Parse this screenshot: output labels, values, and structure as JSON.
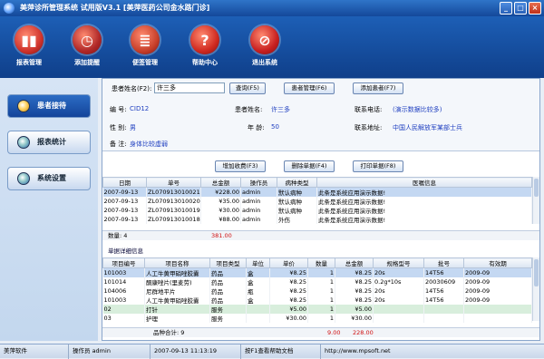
{
  "window": {
    "title": "美萍诊所管理系统 试用版V3.1 [美萍医药公司金水路门诊]",
    "minimize": "_",
    "maximize": "□",
    "close": "×"
  },
  "toolbar": [
    {
      "label": "报表管理",
      "icon": "bar-chart-icon",
      "color": "#d0342c",
      "glyph": "▮▮"
    },
    {
      "label": "添加提醒",
      "icon": "clock-icon",
      "color": "#b02828",
      "glyph": "◷"
    },
    {
      "label": "便签管理",
      "icon": "notepad-icon",
      "color": "#c8402a",
      "glyph": "≣"
    },
    {
      "label": "帮助中心",
      "icon": "help-icon",
      "color": "#d02a20",
      "glyph": "?"
    },
    {
      "label": "退出系统",
      "icon": "exit-icon",
      "color": "#c82020",
      "glyph": "⊘"
    }
  ],
  "nav": [
    {
      "label": "患者接待",
      "active": true
    },
    {
      "label": "报表统计",
      "active": false
    },
    {
      "label": "系统设置",
      "active": false
    }
  ],
  "search": {
    "label": "患者姓名(F2):",
    "value": "许三多",
    "query_btn": "查询(F5)",
    "manage_btn": "患者管理(F6)",
    "add_btn": "添加患者(F7)"
  },
  "patient": {
    "id_label": "编    号:",
    "id": "CID12",
    "name_label": "患者姓名:",
    "name": "许三多",
    "phone_label": "联系电话:",
    "phone": "(演示数据比较多)",
    "sex_label": "性    别:",
    "sex": "男",
    "age_label": "年    龄:",
    "age": "50",
    "addr_label": "联系地址:",
    "address": "中国人民解放军某部士兵",
    "note_label": "备    注:",
    "note": "身体比较虚弱"
  },
  "record_buttons": {
    "add": "增加收费(F3)",
    "delete": "删除单据(F4)",
    "print": "打印单据(F8)"
  },
  "records": {
    "headers": [
      "日期",
      "单号",
      "总金额",
      "操作员",
      "病种类型",
      "医嘱信息"
    ],
    "rows": [
      [
        "2007-09-13",
        "ZL070913010021",
        "¥228.00",
        "admin",
        "默认病种",
        "此条是系统应用演示数据!"
      ],
      [
        "2007-09-13",
        "ZL070913010020",
        "¥35.00",
        "admin",
        "默认病种",
        "此条是系统应用演示数据!"
      ],
      [
        "2007-09-13",
        "ZL070913010019",
        "¥30.00",
        "admin",
        "默认病种",
        "此条是系统应用演示数据!"
      ],
      [
        "2007-09-13",
        "ZL070913010018",
        "¥88.00",
        "admin",
        "外伤",
        "此条是系统应用演示数据!"
      ]
    ],
    "count_label": "数量: 4",
    "total": "381.00"
  },
  "detail": {
    "title": "单据详细信息",
    "headers": [
      "项目编号",
      "项目名称",
      "项目类型",
      "单位",
      "单价",
      "数量",
      "总金额",
      "规格型号",
      "批号",
      "有效期"
    ],
    "rows": [
      [
        "101003",
        "人工牛黄甲硝唑胶囊",
        "药品",
        "盒",
        "¥8.25",
        "1",
        "¥8.25",
        "20s",
        "14T56",
        "2009-09"
      ],
      [
        "101014",
        "酮康唑片(里麦劳)",
        "药品",
        "盒",
        "¥8.25",
        "1",
        "¥8.25",
        "0.2g*10s",
        "20030609",
        "2009-09"
      ],
      [
        "104006",
        "尼群地平片",
        "药品",
        "瓶",
        "¥8.25",
        "1",
        "¥8.25",
        "20s",
        "14T56",
        "2009-09"
      ],
      [
        "101003",
        "人工牛黄甲硝唑胶囊",
        "药品",
        "盒",
        "¥8.25",
        "1",
        "¥8.25",
        "20s",
        "14T56",
        "2009-09"
      ],
      [
        "02",
        "打针",
        "服务",
        "",
        "¥5.00",
        "1",
        "¥5.00",
        "",
        "",
        ""
      ],
      [
        "03",
        "护理",
        "服务",
        "",
        "¥30.00",
        "1",
        "¥30.00",
        "",
        "",
        ""
      ]
    ],
    "sum_label": "品种合计: 9",
    "sum_qty": "9.00",
    "sum_total": "228.00"
  },
  "status": {
    "company": "美萍软件",
    "operator": "操作员 admin",
    "datetime": "2007-09-13 11:13:19",
    "help": "按F1查看帮助文档",
    "website": "http://www.mpsoft.net"
  }
}
